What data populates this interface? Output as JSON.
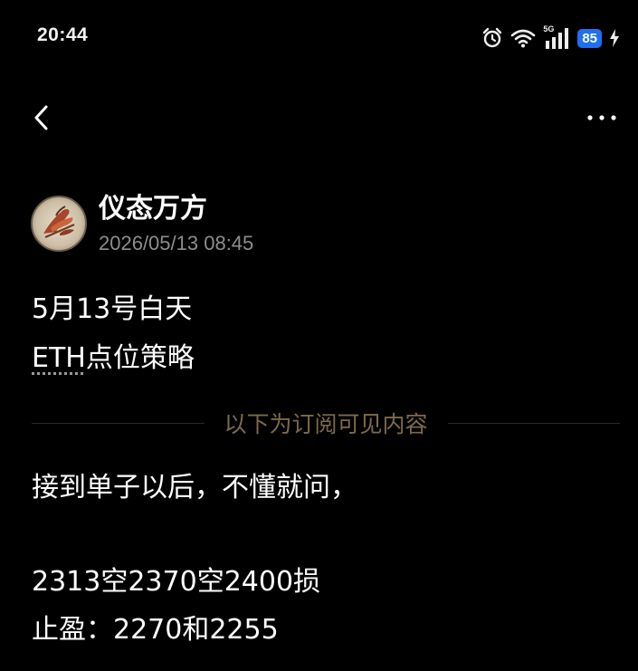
{
  "status_bar": {
    "time": "20:44",
    "network": "5G",
    "battery": "85",
    "icons": [
      "alarm-icon",
      "wifi-icon",
      "signal-icon",
      "battery-icon",
      "charging-icon"
    ]
  },
  "nav": {
    "back_icon": "chevron-left-icon",
    "more_icon": "more-dots-icon"
  },
  "author": {
    "name": "仪态万方",
    "post_time": "2026/05/13 08:45"
  },
  "post": {
    "line1": "5月13号白天",
    "line2_term": "ETH",
    "line2_rest": "点位策略",
    "paywall_label": "以下为订阅可见内容",
    "line3": "接到单子以后，不懂就问，",
    "line4": "2313空2370空2400损",
    "line5": "止盈：2270和2255"
  },
  "colors": {
    "background": "#000000",
    "text": "#ffffff",
    "muted": "#8d8d8d",
    "paywall_gold": "#7d6a4d",
    "battery_blue": "#1f6ff0"
  }
}
